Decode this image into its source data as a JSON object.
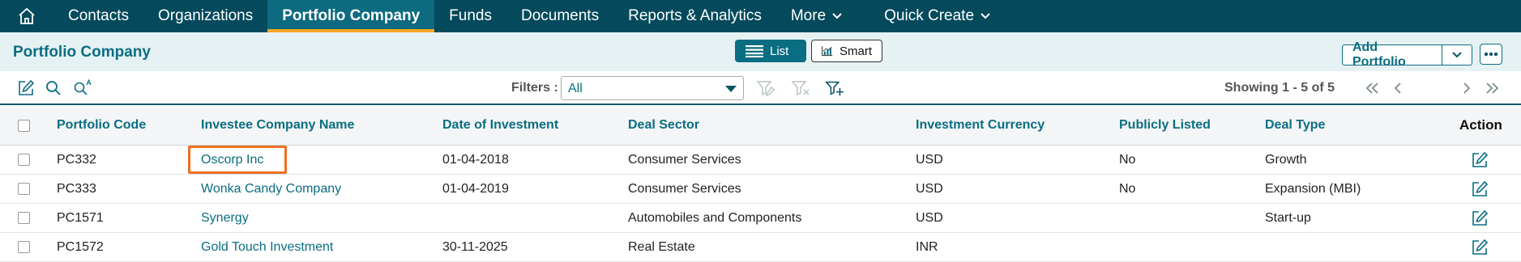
{
  "nav": {
    "items": [
      {
        "label": "Contacts"
      },
      {
        "label": "Organizations"
      },
      {
        "label": "Portfolio Company"
      },
      {
        "label": "Funds"
      },
      {
        "label": "Documents"
      },
      {
        "label": "Reports & Analytics"
      },
      {
        "label": "More"
      },
      {
        "label": "Quick Create"
      }
    ]
  },
  "header": {
    "title": "Portfolio Company",
    "list_label": "List",
    "smart_label": "Smart",
    "add_label": "Add Portfolio"
  },
  "toolbar": {
    "filters_label": "Filters :",
    "filter_value": "All",
    "showing": "Showing 1 - 5 of 5"
  },
  "table": {
    "columns": [
      "Portfolio Code",
      "Investee Company Name",
      "Date of Investment",
      "Deal Sector",
      "Investment Currency",
      "Publicly Listed",
      "Deal Type",
      "Action"
    ],
    "rows": [
      [
        "PC332",
        "Oscorp Inc",
        "01-04-2018",
        "Consumer Services",
        "USD",
        "No",
        "Growth"
      ],
      [
        "PC333",
        "Wonka Candy Company",
        "01-04-2019",
        "Consumer Services",
        "USD",
        "No",
        "Expansion (MBI)"
      ],
      [
        "PC1571",
        "Synergy",
        "",
        "Automobiles and Components",
        "USD",
        "",
        "Start-up"
      ],
      [
        "PC1572",
        "Gold Touch Investment",
        "30-11-2025",
        "Real Estate",
        "INR",
        "",
        ""
      ]
    ]
  },
  "colors": {
    "nav_bg": "#044a5c",
    "accent": "#0a6e82",
    "active_underline": "#f5a623",
    "highlight": "#f07020"
  }
}
